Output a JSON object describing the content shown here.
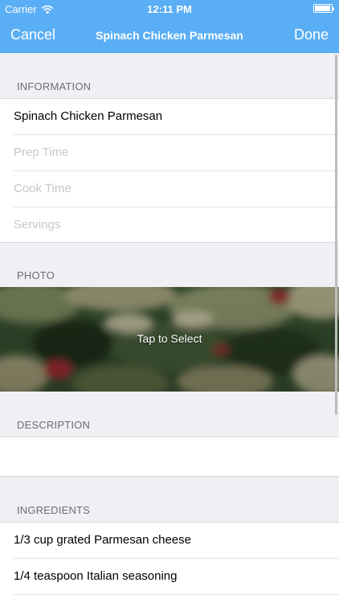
{
  "status_bar": {
    "carrier": "Carrier",
    "time": "12:11 PM"
  },
  "nav": {
    "cancel": "Cancel",
    "title": "Spinach Chicken Parmesan",
    "done": "Done"
  },
  "information": {
    "header": "INFORMATION",
    "name_value": "Spinach Chicken Parmesan",
    "prep_placeholder": "Prep Time",
    "cook_placeholder": "Cook Time",
    "servings_placeholder": "Servings"
  },
  "photo": {
    "header": "PHOTO",
    "tap_label": "Tap to Select"
  },
  "description": {
    "header": "DESCRIPTION",
    "value": ""
  },
  "ingredients": {
    "header": "INGREDIENTS",
    "items": [
      "1/3 cup grated Parmesan cheese",
      "1/4 teaspoon Italian seasoning"
    ]
  },
  "colors": {
    "nav_bar": "#5aaef5",
    "background": "#efeff4",
    "placeholder": "#c7c7cd"
  }
}
